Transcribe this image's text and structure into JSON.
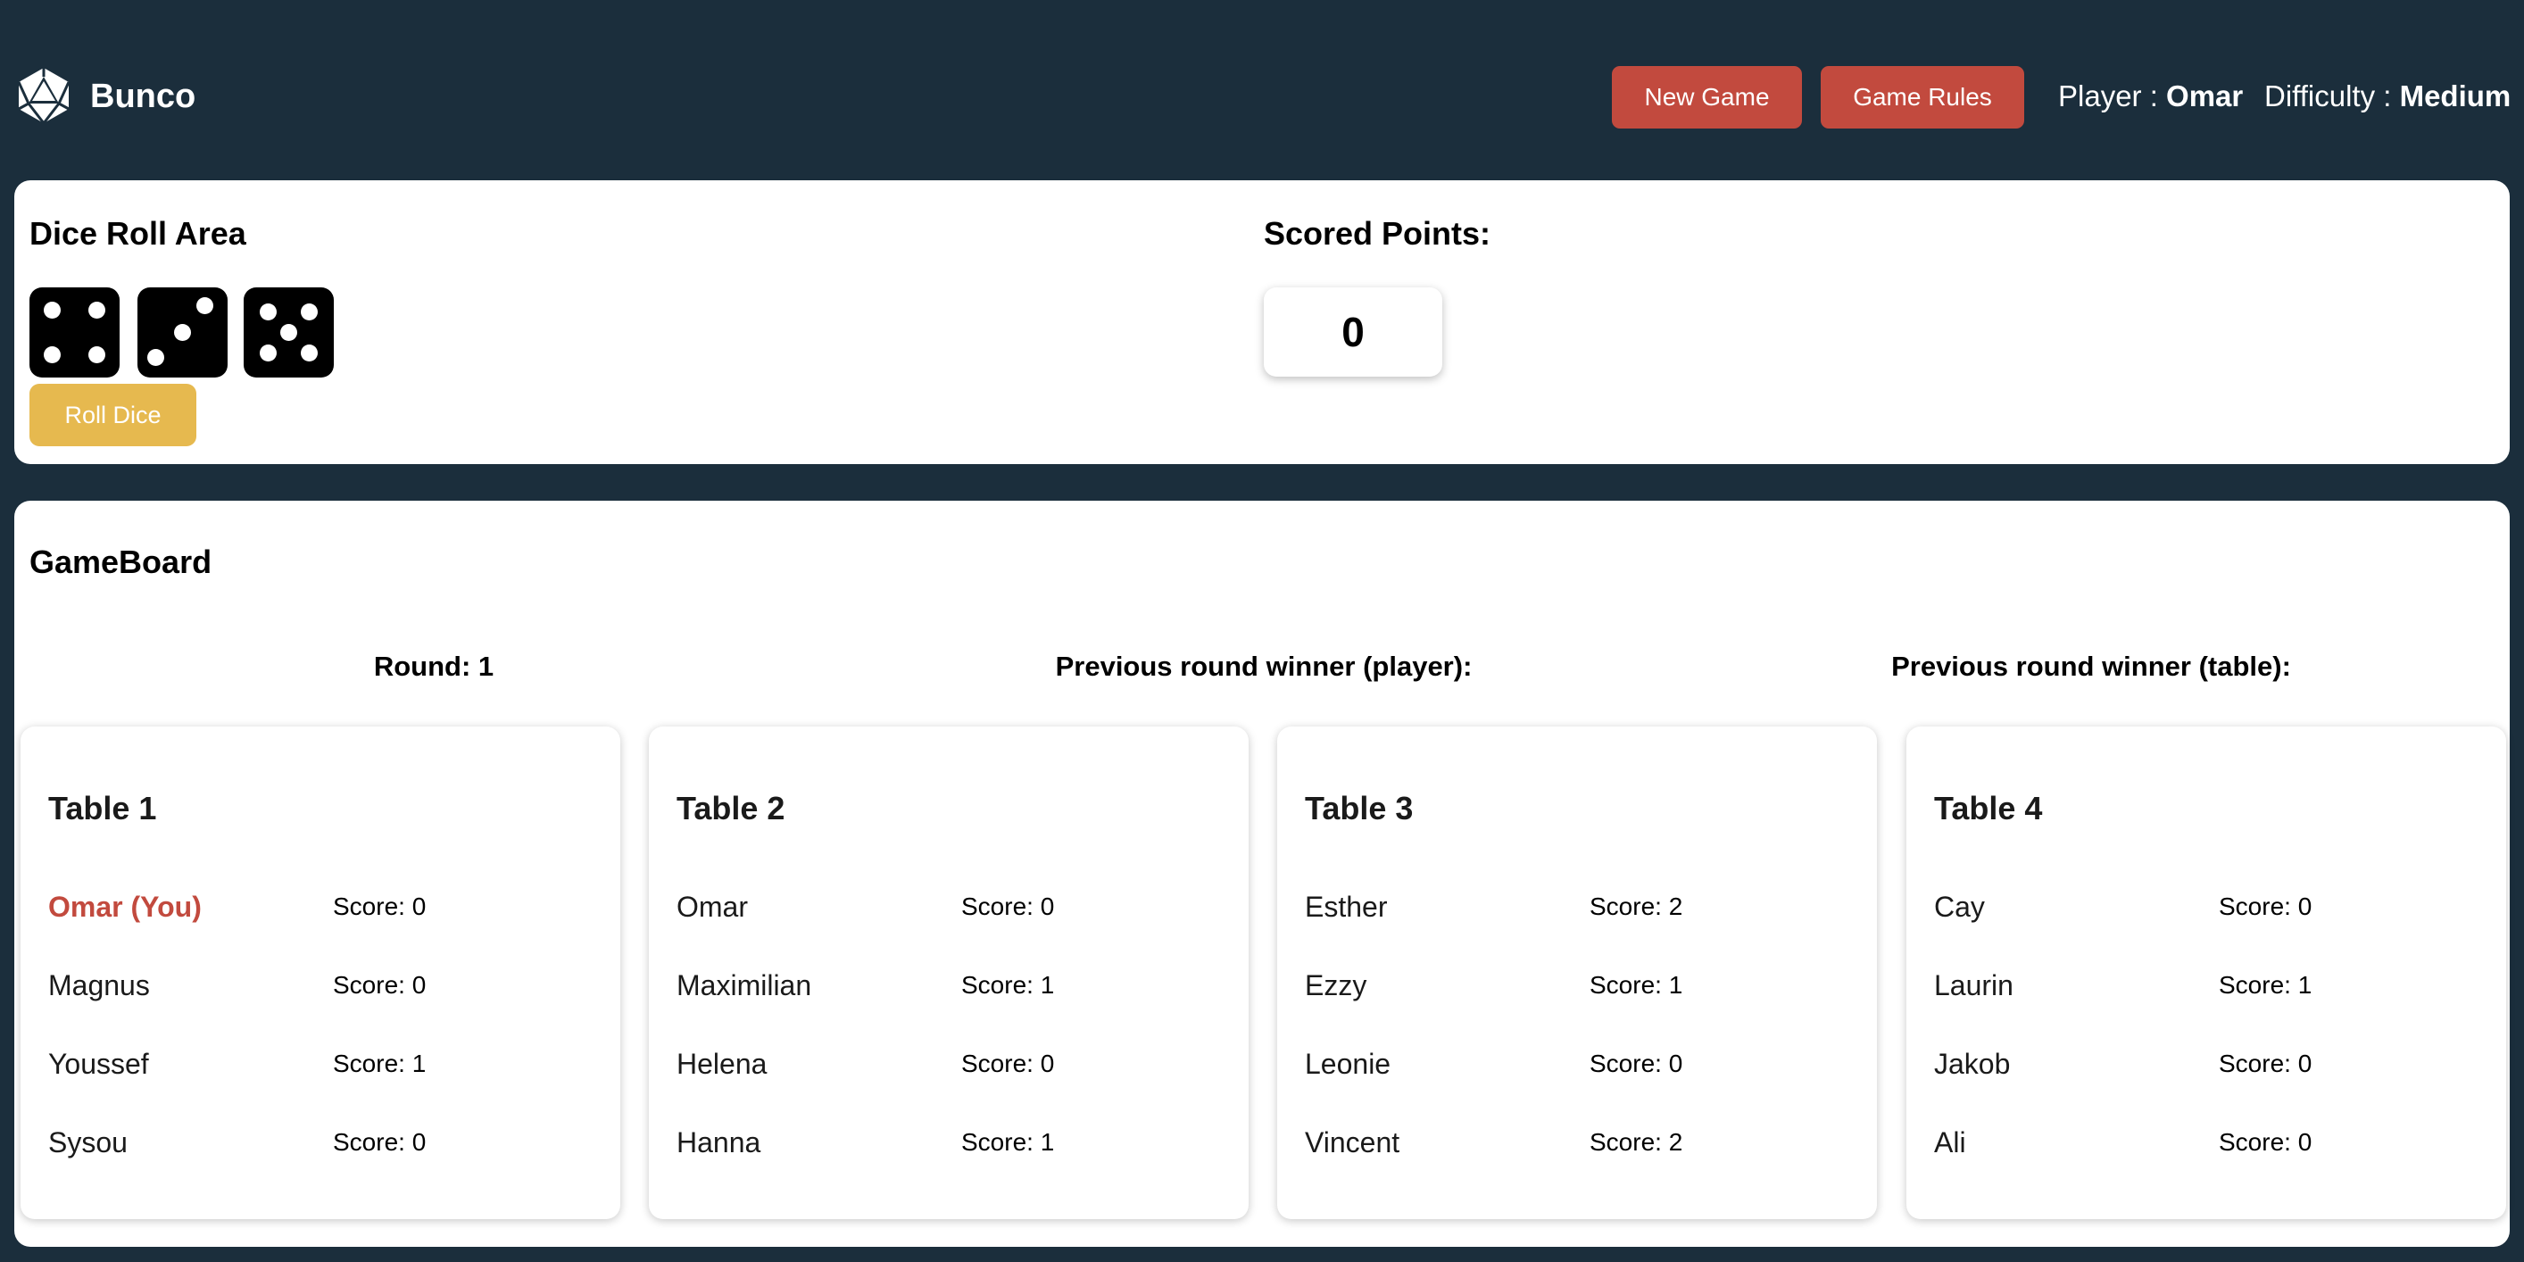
{
  "header": {
    "app_title": "Bunco",
    "logo_icon": "d20-dice-icon",
    "new_game_label": "New Game",
    "game_rules_label": "Game Rules",
    "player_label": "Player : ",
    "player_name": "Omar",
    "difficulty_label": "Difficulty : ",
    "difficulty_value": "Medium"
  },
  "dice_area": {
    "title": "Dice Roll Area",
    "dice": [
      4,
      3,
      5
    ],
    "roll_label": "Roll Dice"
  },
  "scored": {
    "title": "Scored Points:",
    "value": "0"
  },
  "gameboard": {
    "title": "GameBoard",
    "round": "Round: 1",
    "prev_player": "Previous round winner (player):",
    "prev_table": "Previous round winner (table):",
    "tables": [
      {
        "name": "Table 1",
        "players": [
          {
            "name": "Omar (You)",
            "score": "Score: 0"
          },
          {
            "name": "Magnus",
            "score": "Score: 0"
          },
          {
            "name": "Youssef",
            "score": "Score: 1"
          },
          {
            "name": "Sysou",
            "score": "Score: 0"
          }
        ]
      },
      {
        "name": "Table 2",
        "players": [
          {
            "name": "Omar",
            "score": "Score: 0"
          },
          {
            "name": "Maximilian",
            "score": "Score: 1"
          },
          {
            "name": "Helena",
            "score": "Score: 0"
          },
          {
            "name": "Hanna",
            "score": "Score: 1"
          }
        ]
      },
      {
        "name": "Table 3",
        "players": [
          {
            "name": "Esther",
            "score": "Score: 2"
          },
          {
            "name": "Ezzy",
            "score": "Score: 1"
          },
          {
            "name": "Leonie",
            "score": "Score: 0"
          },
          {
            "name": "Vincent",
            "score": "Score: 2"
          }
        ]
      },
      {
        "name": "Table 4",
        "players": [
          {
            "name": "Cay",
            "score": "Score: 0"
          },
          {
            "name": "Laurin",
            "score": "Score: 1"
          },
          {
            "name": "Jakob",
            "score": "Score: 0"
          },
          {
            "name": "Ali",
            "score": "Score: 0"
          }
        ]
      }
    ]
  },
  "colors": {
    "background": "#1b2e3c",
    "accent_red": "#c24a3e",
    "accent_yellow": "#e6b94f"
  }
}
